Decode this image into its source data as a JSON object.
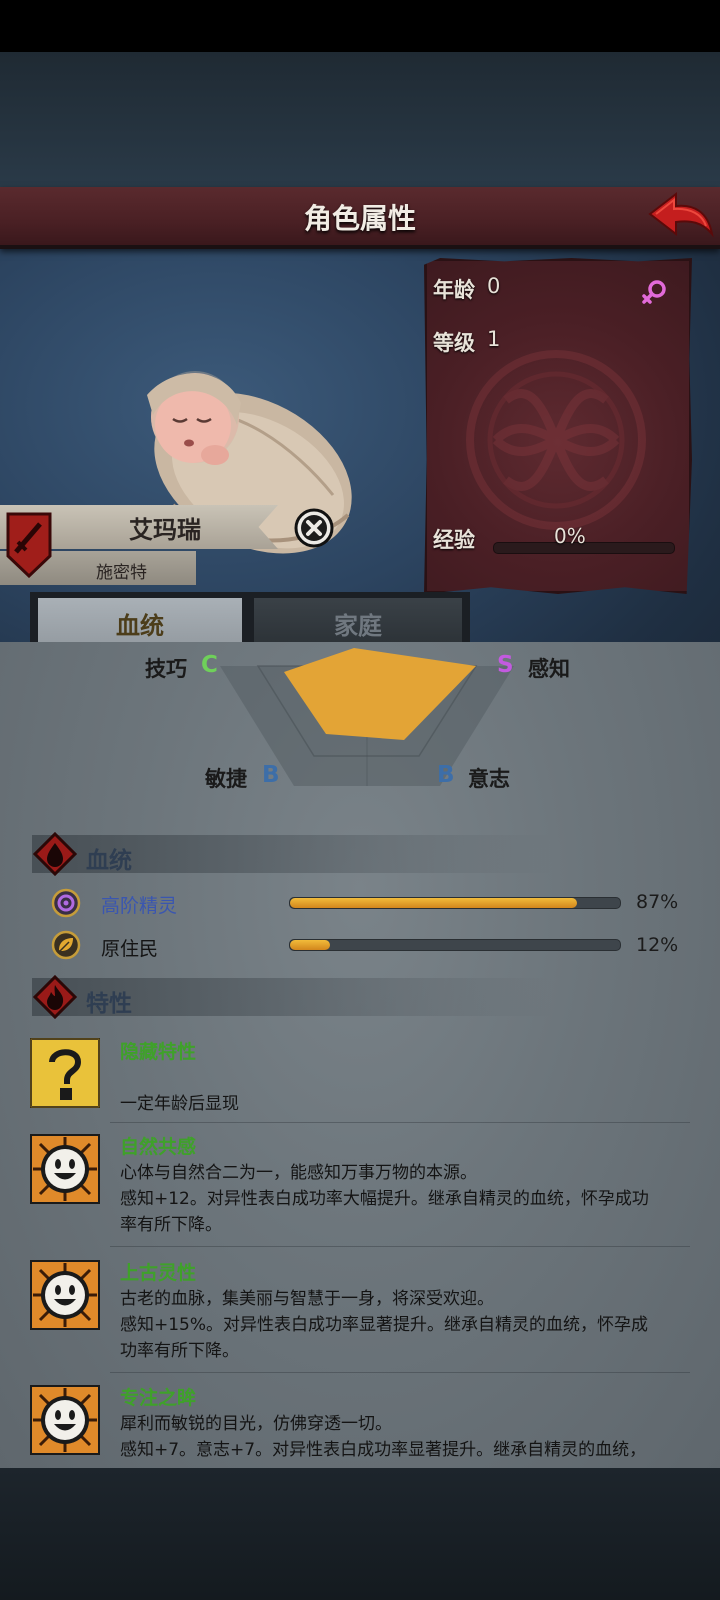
{
  "header": {
    "title": "角色属性",
    "back_icon": "red-arrow-back-icon"
  },
  "character": {
    "name": "艾玛瑞",
    "subname": "施密特",
    "age_label": "年龄",
    "age_value": "0",
    "level_label": "等级",
    "level_value": "1",
    "exp_label": "经验",
    "exp_value": "0%",
    "exp_fraction": 0,
    "gender_icon": "female-icon"
  },
  "tabs": [
    {
      "label": "血统",
      "active": true
    },
    {
      "label": "家庭",
      "active": false
    }
  ],
  "stats": {
    "skill_name": "技巧",
    "skill_grade": "C",
    "perception_name": "感知",
    "perception_grade": "S",
    "agility_name": "敏捷",
    "agility_grade": "B",
    "will_name": "意志",
    "will_grade": "B"
  },
  "colors": {
    "grade_C": "#6fd05a",
    "grade_S": "#c35ae0",
    "grade_B": "#3d6ea8",
    "radar_fill": "#e3a436",
    "trait_name": "#3fa12a"
  },
  "lineage": {
    "title": "血统",
    "items": [
      {
        "name": "高阶精灵",
        "percent_label": "87%",
        "percent": 87,
        "icon": "purple-swirl-icon",
        "color": "#3a56b0"
      },
      {
        "name": "原住民",
        "percent_label": "12%",
        "percent": 12,
        "icon": "leaf-icon",
        "color": "#141414"
      }
    ]
  },
  "traits_section": {
    "title": "特性"
  },
  "traits": [
    {
      "name": "隐藏特性",
      "lines": [
        "",
        "一定年龄后显现"
      ],
      "icon": "question-mark-icon"
    },
    {
      "name": "自然共感",
      "lines": [
        "心体与自然合二为一，能感知万事万物的本源。",
        "感知+12。对异性表白成功率大幅提升。继承自精灵的血统，怀孕成功",
        "率有所下降。"
      ],
      "icon": "smiley-sun-icon"
    },
    {
      "name": "上古灵性",
      "lines": [
        "古老的血脉，集美丽与智慧于一身，将深受欢迎。",
        "感知+15%。对异性表白成功率显著提升。继承自精灵的血统，怀孕成",
        "功率有所下降。"
      ],
      "icon": "smiley-sun-icon"
    },
    {
      "name": "专注之眸",
      "lines": [
        "犀利而敏锐的目光，仿佛穿透一切。",
        "感知+7。意志+7。对异性表白成功率显著提升。继承自精灵的血统，"
      ],
      "icon": "smiley-sun-icon"
    }
  ]
}
